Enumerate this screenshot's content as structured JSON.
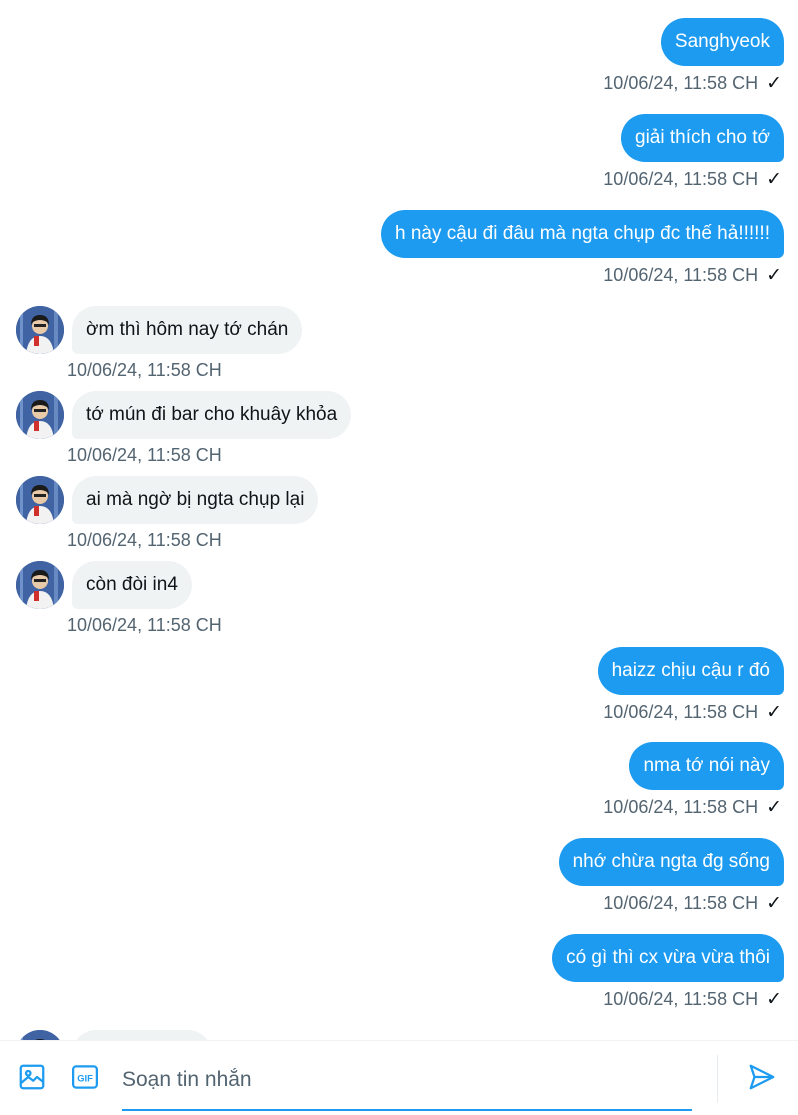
{
  "messages": [
    {
      "side": "sent",
      "text": "Sanghyeok",
      "time": "10/06/24, 11:58 CH"
    },
    {
      "side": "sent",
      "text": "giải thích cho tớ",
      "time": "10/06/24, 11:58 CH"
    },
    {
      "side": "sent",
      "text": "h này cậu đi đâu mà ngta chụp đc thế hả!!!!!!",
      "time": "10/06/24, 11:58 CH"
    },
    {
      "side": "recv",
      "text": "ờm thì hôm nay tớ chán",
      "time": "10/06/24, 11:58 CH"
    },
    {
      "side": "recv",
      "text": "tớ mún đi bar cho khuây khỏa",
      "time": "10/06/24, 11:58 CH"
    },
    {
      "side": "recv",
      "text": "ai mà ngờ bị ngta chụp lại",
      "time": "10/06/24, 11:58 CH"
    },
    {
      "side": "recv",
      "text": "còn đòi in4",
      "time": "10/06/24, 11:58 CH"
    },
    {
      "side": "sent",
      "text": "haizz chịu cậu r đó",
      "time": "10/06/24, 11:58 CH"
    },
    {
      "side": "sent",
      "text": "nma tớ nói này",
      "time": "10/06/24, 11:58 CH"
    },
    {
      "side": "sent",
      "text": "nhớ chừa ngta đg sống",
      "time": "10/06/24, 11:58 CH"
    },
    {
      "side": "sent",
      "text": "có gì thì cx vừa vừa thôi",
      "time": "10/06/24, 11:58 CH"
    }
  ],
  "sent_tick": "✓",
  "composer": {
    "placeholder": "Soạn tin nhắn",
    "gif_label": "GIF",
    "icons": {
      "media": "image-icon",
      "gif": "gif-icon",
      "send": "send-icon"
    }
  },
  "colors": {
    "accent": "#1d9bf0",
    "bubble_received": "#eff3f4",
    "meta_text": "#536471"
  }
}
